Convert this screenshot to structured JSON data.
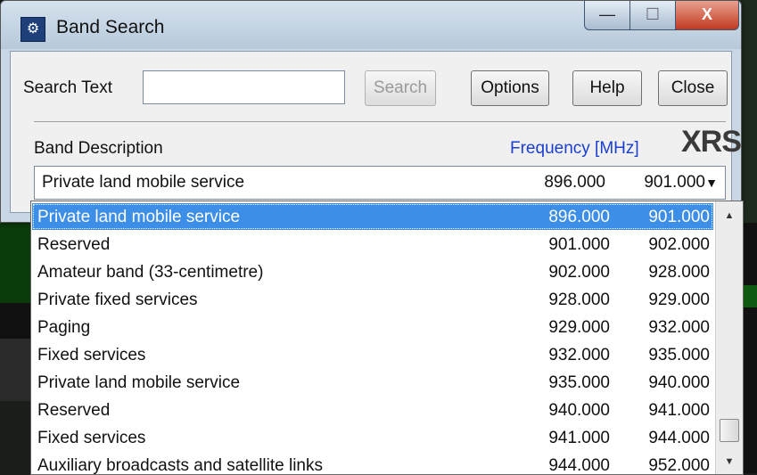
{
  "window": {
    "title": "Band Search",
    "controls": {
      "minimize": "—",
      "maximize": "☐",
      "close": "X"
    }
  },
  "search": {
    "label": "Search Text",
    "value": "",
    "placeholder": ""
  },
  "buttons": {
    "search": "Search",
    "options": "Options",
    "help": "Help",
    "close": "Close"
  },
  "band": {
    "description_label": "Band Description",
    "frequency_label": "Frequency [MHz]",
    "logo": "XRS",
    "selected": {
      "description": "Private land mobile service",
      "start": "896.000",
      "end": "901.000"
    }
  },
  "list": [
    {
      "description": "Private land mobile service",
      "start": "896.000",
      "end": "901.000",
      "selected": true
    },
    {
      "description": "Reserved",
      "start": "901.000",
      "end": "902.000"
    },
    {
      "description": "Amateur band (33-centimetre)",
      "start": "902.000",
      "end": "928.000"
    },
    {
      "description": "Private fixed services",
      "start": "928.000",
      "end": "929.000"
    },
    {
      "description": "Paging",
      "start": "929.000",
      "end": "932.000"
    },
    {
      "description": "Fixed services",
      "start": "932.000",
      "end": "935.000"
    },
    {
      "description": "Private land mobile service",
      "start": "935.000",
      "end": "940.000"
    },
    {
      "description": "Reserved",
      "start": "940.000",
      "end": "941.000"
    },
    {
      "description": "Fixed services",
      "start": "941.000",
      "end": "944.000"
    },
    {
      "description": "Auxiliary broadcasts and satellite links",
      "start": "944.000",
      "end": "952.000"
    }
  ],
  "icons": {
    "app": "band-search-icon",
    "dropdown": "chevron-down-icon",
    "scroll_up": "scroll-up-icon",
    "scroll_down": "scroll-down-icon"
  },
  "colors": {
    "selection": "#3d8ee6",
    "frequency_label": "#1a3fd0",
    "close_button": "#c23a20"
  }
}
